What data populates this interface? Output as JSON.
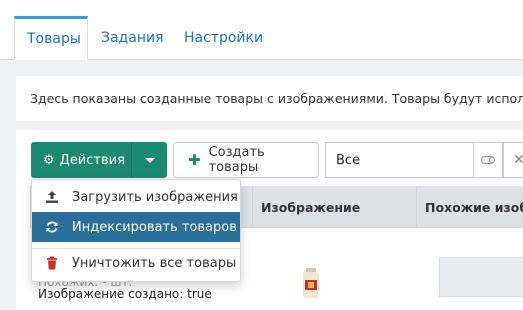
{
  "tabs": [
    {
      "label": "Товары",
      "active": true
    },
    {
      "label": "Задания",
      "active": false
    },
    {
      "label": "Настройки",
      "active": false
    }
  ],
  "notice": "Здесь показаны созданные товары с изображениями. Товары будут использова",
  "toolbar": {
    "actions_label": "Действия",
    "create_label": "Создать товары",
    "filter_value": "Все"
  },
  "table": {
    "columns": [
      "Изображение",
      "Похожие изобраз"
    ]
  },
  "row": {
    "similar_label": "Похожих: - шт.",
    "created_label": "Изображение создано: true"
  },
  "dropdown": {
    "items": [
      {
        "label": "Загрузить изображения",
        "icon": "upload-icon"
      },
      {
        "label": "Индексировать товаров",
        "icon": "refresh-icon",
        "active": true
      },
      {
        "label": "Уничтожить все товары",
        "icon": "trash-icon"
      }
    ]
  },
  "colors": {
    "primary_green": "#1c8a70",
    "active_blue": "#2a6f99",
    "link_blue": "#1a73c9",
    "danger_red": "#c9302c"
  }
}
